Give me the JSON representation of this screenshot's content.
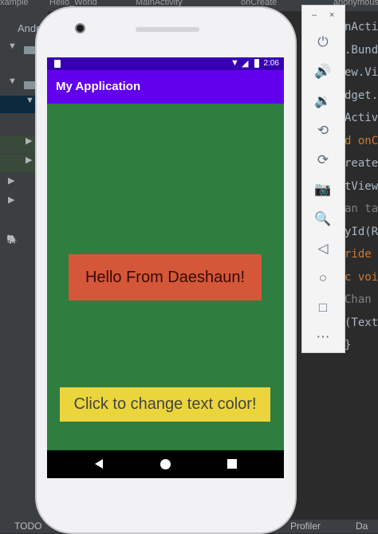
{
  "ide": {
    "topbar": [
      "xample",
      "Hello_World",
      "MainActivity",
      "onCreate",
      "anonymous"
    ],
    "project_label": "Andr",
    "bottombar": {
      "todo": "TODO",
      "profiler": "Profiler",
      "data": "Da"
    },
    "code_lines": [
      {
        "text": "nActivi",
        "cls": ""
      },
      {
        "text": ".Bund",
        "cls": ""
      },
      {
        "text": "ew.Vi",
        "cls": ""
      },
      {
        "text": "dget.",
        "cls": ""
      },
      {
        "text": "Activ",
        "cls": ""
      },
      {
        "text": "d onC",
        "cls": "kw"
      },
      {
        "text": "reate",
        "cls": ""
      },
      {
        "text": "tView",
        "cls": ""
      },
      {
        "text": "an ta",
        "cls": "cm"
      },
      {
        "text": "yId(R",
        "cls": ""
      },
      {
        "text": "ride",
        "cls": "kw"
      },
      {
        "text": "c voi",
        "cls": "kw"
      },
      {
        "text": " Chan",
        "cls": "cm"
      },
      {
        "text": "(Text",
        "cls": ""
      },
      {
        "text": "}",
        "cls": ""
      }
    ]
  },
  "phone": {
    "status": {
      "time": "2:06"
    },
    "app_title": "My Application",
    "hello_text": "Hello From Daeshaun!",
    "button_label": "Click to change text color!",
    "colors": {
      "background": "#2f7d3f",
      "hello_bg": "#d4573a",
      "button_bg": "#ecd53b",
      "appbar": "#6200ee",
      "statusbar": "#3700b3"
    }
  },
  "emulator": {
    "window_controls": {
      "minimize": "–",
      "close": "×"
    },
    "tools": [
      {
        "name": "power-icon",
        "glyph": "⏻"
      },
      {
        "name": "volume-up-icon",
        "glyph": "🔊"
      },
      {
        "name": "volume-down-icon",
        "glyph": "🔉"
      },
      {
        "name": "rotate-left-icon",
        "glyph": "⟲"
      },
      {
        "name": "rotate-right-icon",
        "glyph": "⟳"
      },
      {
        "name": "camera-icon",
        "glyph": "📷"
      },
      {
        "name": "zoom-icon",
        "glyph": "🔍"
      },
      {
        "name": "back-icon",
        "glyph": "◁"
      },
      {
        "name": "home-icon",
        "glyph": "○"
      },
      {
        "name": "overview-icon",
        "glyph": "□"
      },
      {
        "name": "more-icon",
        "glyph": "⋯"
      }
    ]
  }
}
